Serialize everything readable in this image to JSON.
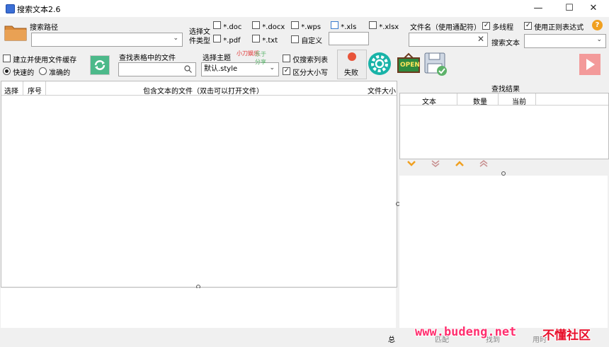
{
  "window": {
    "title": "搜索文本2.6",
    "minimize": "—",
    "maximize": "☐",
    "close": "✕"
  },
  "search_path": {
    "label": "搜索路径",
    "value": ""
  },
  "file_type": {
    "label_line1": "选择文",
    "label_line2": "件类型",
    "options": [
      {
        "label": "*.doc",
        "checked": false
      },
      {
        "label": "*.docx",
        "checked": false
      },
      {
        "label": "*.wps",
        "checked": false
      },
      {
        "label": "*.xls",
        "checked": false
      },
      {
        "label": "*.xlsx",
        "checked": false
      },
      {
        "label": "*.pdf",
        "checked": false
      },
      {
        "label": "*.txt",
        "checked": false
      },
      {
        "label": "自定义",
        "checked": false
      }
    ],
    "custom_value": ""
  },
  "filename_filter": {
    "label": "文件名（使用通配符）",
    "value": "",
    "clear": "✕"
  },
  "options": {
    "multithread": "多线程",
    "regex": "使用正则表达式",
    "search_text_label": "搜索文本",
    "help": "?"
  },
  "cache": {
    "label": "建立并使用文件缓存",
    "fast": "快速的",
    "accurate": "准确的"
  },
  "table_search": {
    "label": "查找表格中的文件",
    "value": ""
  },
  "theme": {
    "label": "选择主题",
    "value": "默认.style"
  },
  "only_list": "仅搜索列表",
  "case_sensitive": "区分大小写",
  "fail_button": "失败",
  "open_badge": "OPEN",
  "file_table": {
    "col_select": "选择",
    "col_index": "序号",
    "col_file": "包含文本的文件（双击可以打开文件）",
    "col_size": "文件大小"
  },
  "results": {
    "title": "查找结果",
    "col_text": "文本",
    "col_count": "数量",
    "col_current": "当前"
  },
  "status": {
    "total": "总",
    "s2": "匹配",
    "s3": "找到",
    "s4": "用时"
  },
  "watermark": {
    "text1": "www.budeng.net",
    "text2": "不懂社区",
    "stamp1": "小刀娱乐",
    "stamp2": "乐于分享"
  }
}
